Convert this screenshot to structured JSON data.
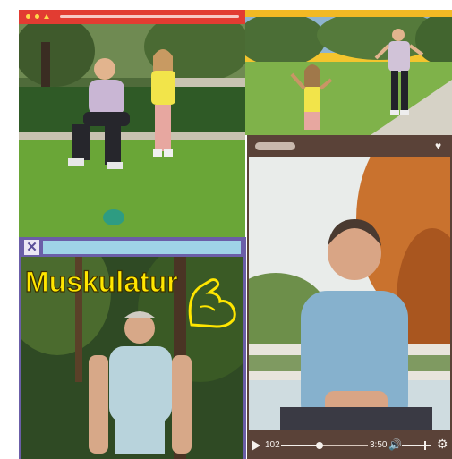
{
  "window_top_left": {
    "title_dots": 3
  },
  "window_bottom_left": {
    "close_glyph": "✕",
    "overlay_text": "Muskulatur"
  },
  "window_right": {
    "player": {
      "current_time": "102",
      "duration": "3:50",
      "progress_fraction": 0.44,
      "volume_fraction": 0.75
    }
  },
  "icons": [
    "heart-icon",
    "play-icon",
    "volume-icon",
    "gear-icon",
    "close-icon",
    "flexed-arm-icon"
  ],
  "colors": {
    "red": "#e23c32",
    "yellow": "#f4c52e",
    "purple": "#6b5ea8",
    "brown": "#5a4238",
    "text_yellow": "#ffe600"
  }
}
